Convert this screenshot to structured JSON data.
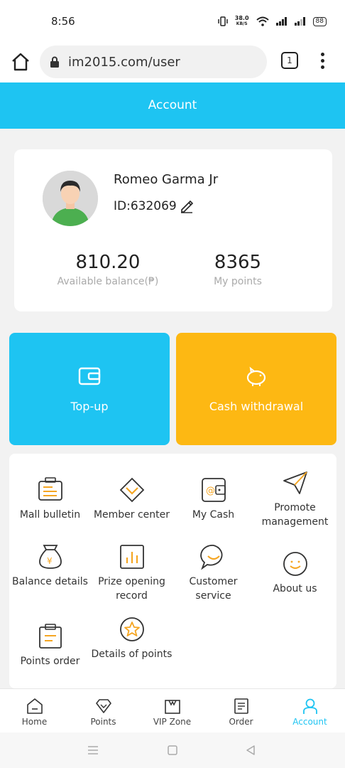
{
  "status_bar": {
    "time": "8:56",
    "net_speed_top": "38.0",
    "net_speed_unit": "KB/S",
    "battery": "88"
  },
  "browser": {
    "url": "im2015.com/user",
    "tab_count": "1"
  },
  "header": {
    "title": "Account"
  },
  "profile": {
    "name": "Romeo Garma Jr",
    "id_label": "ID:632069",
    "balance_value": "810.20",
    "balance_label": "Available balance(₱)",
    "points_value": "8365",
    "points_label": "My points"
  },
  "actions": {
    "topup_label": "Top-up",
    "withdraw_label": "Cash withdrawal"
  },
  "menu": {
    "items": [
      {
        "label": "Mall bulletin",
        "icon": "bulletin-icon"
      },
      {
        "label": "Member center",
        "icon": "diamond-icon"
      },
      {
        "label": "My Cash",
        "icon": "wallet-icon"
      },
      {
        "label": "Promote management",
        "icon": "paper-plane-icon"
      },
      {
        "label": "Balance details",
        "icon": "money-bag-icon"
      },
      {
        "label": "Prize opening record",
        "icon": "bar-chart-icon"
      },
      {
        "label": "Customer service",
        "icon": "chat-bubble-icon"
      },
      {
        "label": "About us",
        "icon": "smile-icon"
      },
      {
        "label": "Points order",
        "icon": "clipboard-icon"
      },
      {
        "label": "Details of points",
        "icon": "star-icon"
      }
    ]
  },
  "bottom_nav": {
    "items": [
      {
        "label": "Home"
      },
      {
        "label": "Points"
      },
      {
        "label": "VIP Zone"
      },
      {
        "label": "Order"
      },
      {
        "label": "Account"
      }
    ]
  },
  "colors": {
    "accent_blue": "#1ec4f2",
    "accent_yellow": "#fdb813",
    "icon_orange": "#f5a623"
  }
}
